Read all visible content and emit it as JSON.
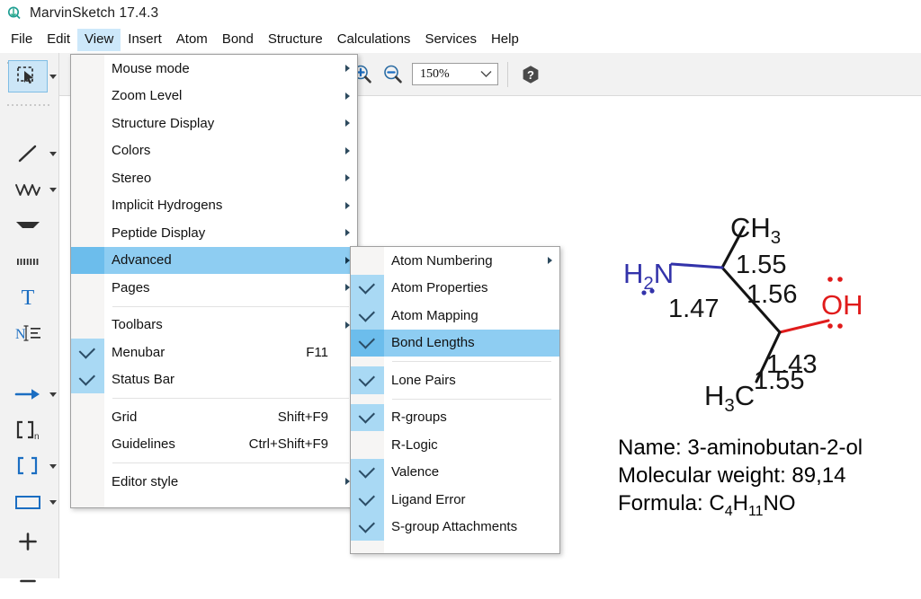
{
  "window": {
    "title": "MarvinSketch 17.4.3",
    "icon": "marvinsketch-logo-icon"
  },
  "colors": {
    "menu_highlight": "#8ecdf2",
    "check_cell": "#a9d9f4",
    "check_cell_highlight": "#6cbdec",
    "toolbar_bg": "#f2f2f2",
    "tool_selected_bg": "#cce6f7",
    "nitrogen_blue": "#3333aa",
    "oxygen_red": "#e01b1b",
    "accent_blue": "#1b6ec2"
  },
  "menubar": {
    "items": [
      {
        "label": "File",
        "active": false
      },
      {
        "label": "Edit",
        "active": false
      },
      {
        "label": "View",
        "active": true
      },
      {
        "label": "Insert",
        "active": false
      },
      {
        "label": "Atom",
        "active": false
      },
      {
        "label": "Bond",
        "active": false
      },
      {
        "label": "Structure",
        "active": false
      },
      {
        "label": "Calculations",
        "active": false
      },
      {
        "label": "Services",
        "active": false
      },
      {
        "label": "Help",
        "active": false
      }
    ]
  },
  "top_toolbar": {
    "zoom_in_icon": "zoom-in-icon",
    "zoom_out_icon": "zoom-out-icon",
    "zoom_value": "150%",
    "zoom_dropdown_icon": "chevron-down-icon",
    "help_icon": "help-icon"
  },
  "left_toolbar": {
    "tools": [
      {
        "name": "selection-tool",
        "icon": "lasso-pointer-icon",
        "selected": true,
        "has_caret": true
      },
      {
        "name": "single-bond-tool",
        "icon": "bond-line-icon",
        "selected": false,
        "has_caret": true
      },
      {
        "name": "chain-tool",
        "icon": "zigzag-chain-icon",
        "selected": false,
        "has_caret": true
      },
      {
        "name": "wedge-bond-tool",
        "icon": "wedge-bond-icon",
        "selected": false,
        "has_caret": false
      },
      {
        "name": "hashed-bond-tool",
        "icon": "hashed-bond-icon",
        "selected": false,
        "has_caret": false
      },
      {
        "name": "text-tool",
        "icon": "text-T-icon",
        "selected": false,
        "has_caret": false
      },
      {
        "name": "atom-label-tool",
        "icon": "atom-label-icon",
        "selected": false,
        "has_caret": false
      },
      {
        "name": "reaction-arrow-tool",
        "icon": "right-arrow-icon",
        "selected": false,
        "has_caret": true
      },
      {
        "name": "repeating-unit-tool",
        "icon": "bracket-n-icon",
        "selected": false,
        "has_caret": false
      },
      {
        "name": "bracket-tool",
        "icon": "brackets-icon",
        "selected": false,
        "has_caret": true
      },
      {
        "name": "rectangle-tool",
        "icon": "rectangle-icon",
        "selected": false,
        "has_caret": true
      },
      {
        "name": "increase-charge-tool",
        "icon": "plus-icon",
        "selected": false,
        "has_caret": false
      },
      {
        "name": "decrease-charge-tool",
        "icon": "minus-icon",
        "selected": false,
        "has_caret": false
      }
    ]
  },
  "view_menu": {
    "items": [
      {
        "label": "Mouse mode",
        "accel": "",
        "checked": false,
        "submenu": true,
        "highlighted": false,
        "separator_after": false
      },
      {
        "label": "Zoom Level",
        "accel": "",
        "checked": false,
        "submenu": true,
        "highlighted": false,
        "separator_after": false
      },
      {
        "label": "Structure Display",
        "accel": "",
        "checked": false,
        "submenu": true,
        "highlighted": false,
        "separator_after": false
      },
      {
        "label": "Colors",
        "accel": "",
        "checked": false,
        "submenu": true,
        "highlighted": false,
        "separator_after": false
      },
      {
        "label": "Stereo",
        "accel": "",
        "checked": false,
        "submenu": true,
        "highlighted": false,
        "separator_after": false
      },
      {
        "label": "Implicit Hydrogens",
        "accel": "",
        "checked": false,
        "submenu": true,
        "highlighted": false,
        "separator_after": false
      },
      {
        "label": "Peptide Display",
        "accel": "",
        "checked": false,
        "submenu": true,
        "highlighted": false,
        "separator_after": false
      },
      {
        "label": "Advanced",
        "accel": "",
        "checked": false,
        "submenu": true,
        "highlighted": true,
        "separator_after": false
      },
      {
        "label": "Pages",
        "accel": "",
        "checked": false,
        "submenu": true,
        "highlighted": false,
        "separator_after": true
      },
      {
        "label": "Toolbars",
        "accel": "",
        "checked": false,
        "submenu": true,
        "highlighted": false,
        "separator_after": false
      },
      {
        "label": "Menubar",
        "accel": "F11",
        "checked": true,
        "submenu": false,
        "highlighted": false,
        "separator_after": false
      },
      {
        "label": "Status Bar",
        "accel": "",
        "checked": true,
        "submenu": false,
        "highlighted": false,
        "separator_after": true
      },
      {
        "label": "Grid",
        "accel": "Shift+F9",
        "checked": false,
        "submenu": false,
        "highlighted": false,
        "separator_after": false
      },
      {
        "label": "Guidelines",
        "accel": "Ctrl+Shift+F9",
        "checked": false,
        "submenu": false,
        "highlighted": false,
        "separator_after": true
      },
      {
        "label": "Editor style",
        "accel": "",
        "checked": false,
        "submenu": true,
        "highlighted": false,
        "separator_after": false
      }
    ]
  },
  "advanced_submenu": {
    "items": [
      {
        "label": "Atom Numbering",
        "checked": false,
        "submenu": true,
        "highlighted": false,
        "separator_after": false
      },
      {
        "label": "Atom Properties",
        "checked": true,
        "submenu": false,
        "highlighted": false,
        "separator_after": false
      },
      {
        "label": "Atom Mapping",
        "checked": true,
        "submenu": false,
        "highlighted": false,
        "separator_after": false
      },
      {
        "label": "Bond Lengths",
        "checked": true,
        "submenu": false,
        "highlighted": true,
        "separator_after": true
      },
      {
        "label": "Lone Pairs",
        "checked": true,
        "submenu": false,
        "highlighted": false,
        "separator_after": true
      },
      {
        "label": "R-groups",
        "checked": true,
        "submenu": false,
        "highlighted": false,
        "separator_after": false
      },
      {
        "label": "R-Logic",
        "checked": false,
        "submenu": false,
        "highlighted": false,
        "separator_after": false
      },
      {
        "label": "Valence",
        "checked": true,
        "submenu": false,
        "highlighted": false,
        "separator_after": false
      },
      {
        "label": "Ligand Error",
        "checked": true,
        "submenu": false,
        "highlighted": false,
        "separator_after": false
      },
      {
        "label": "S-group Attachments",
        "checked": true,
        "submenu": false,
        "highlighted": false,
        "separator_after": false
      }
    ]
  },
  "canvas": {
    "molecule": {
      "atom_labels": [
        {
          "text": "CH3",
          "main": "CH",
          "sub": "3",
          "color": "#141414"
        },
        {
          "text": "H2N",
          "main": "N",
          "sub": "2",
          "color": "#3333aa"
        },
        {
          "text": "OH",
          "main": "OH",
          "sub": "",
          "color": "#e01b1b"
        },
        {
          "text": "H3C",
          "main": "H",
          "sub": "3",
          "color": "#141414"
        }
      ],
      "bond_lengths": [
        "1.55",
        "1.56",
        "1.47",
        "1.43",
        "1.55"
      ],
      "ch3_top": "CH",
      "ch3_top_sub": "3",
      "h2n_h": "H",
      "h2n_sub": "2",
      "h2n_n": "N",
      "oh": "OH",
      "h3c_h": "H",
      "h3c_sub": "3",
      "h3c_c": "C",
      "len_ch3": "1.55",
      "len_cc": "1.56",
      "len_cn": "1.47",
      "len_oh": "1.43",
      "len_ch3b": "1.55"
    },
    "info": {
      "name_label": "Name: 3-aminobutan-2-ol",
      "mw_label": "Molecular weight: 89,14",
      "formula_prefix": "Formula: C",
      "formula_sub1": "4",
      "formula_mid": "H",
      "formula_sub2": "11",
      "formula_suffix": "NO"
    }
  }
}
